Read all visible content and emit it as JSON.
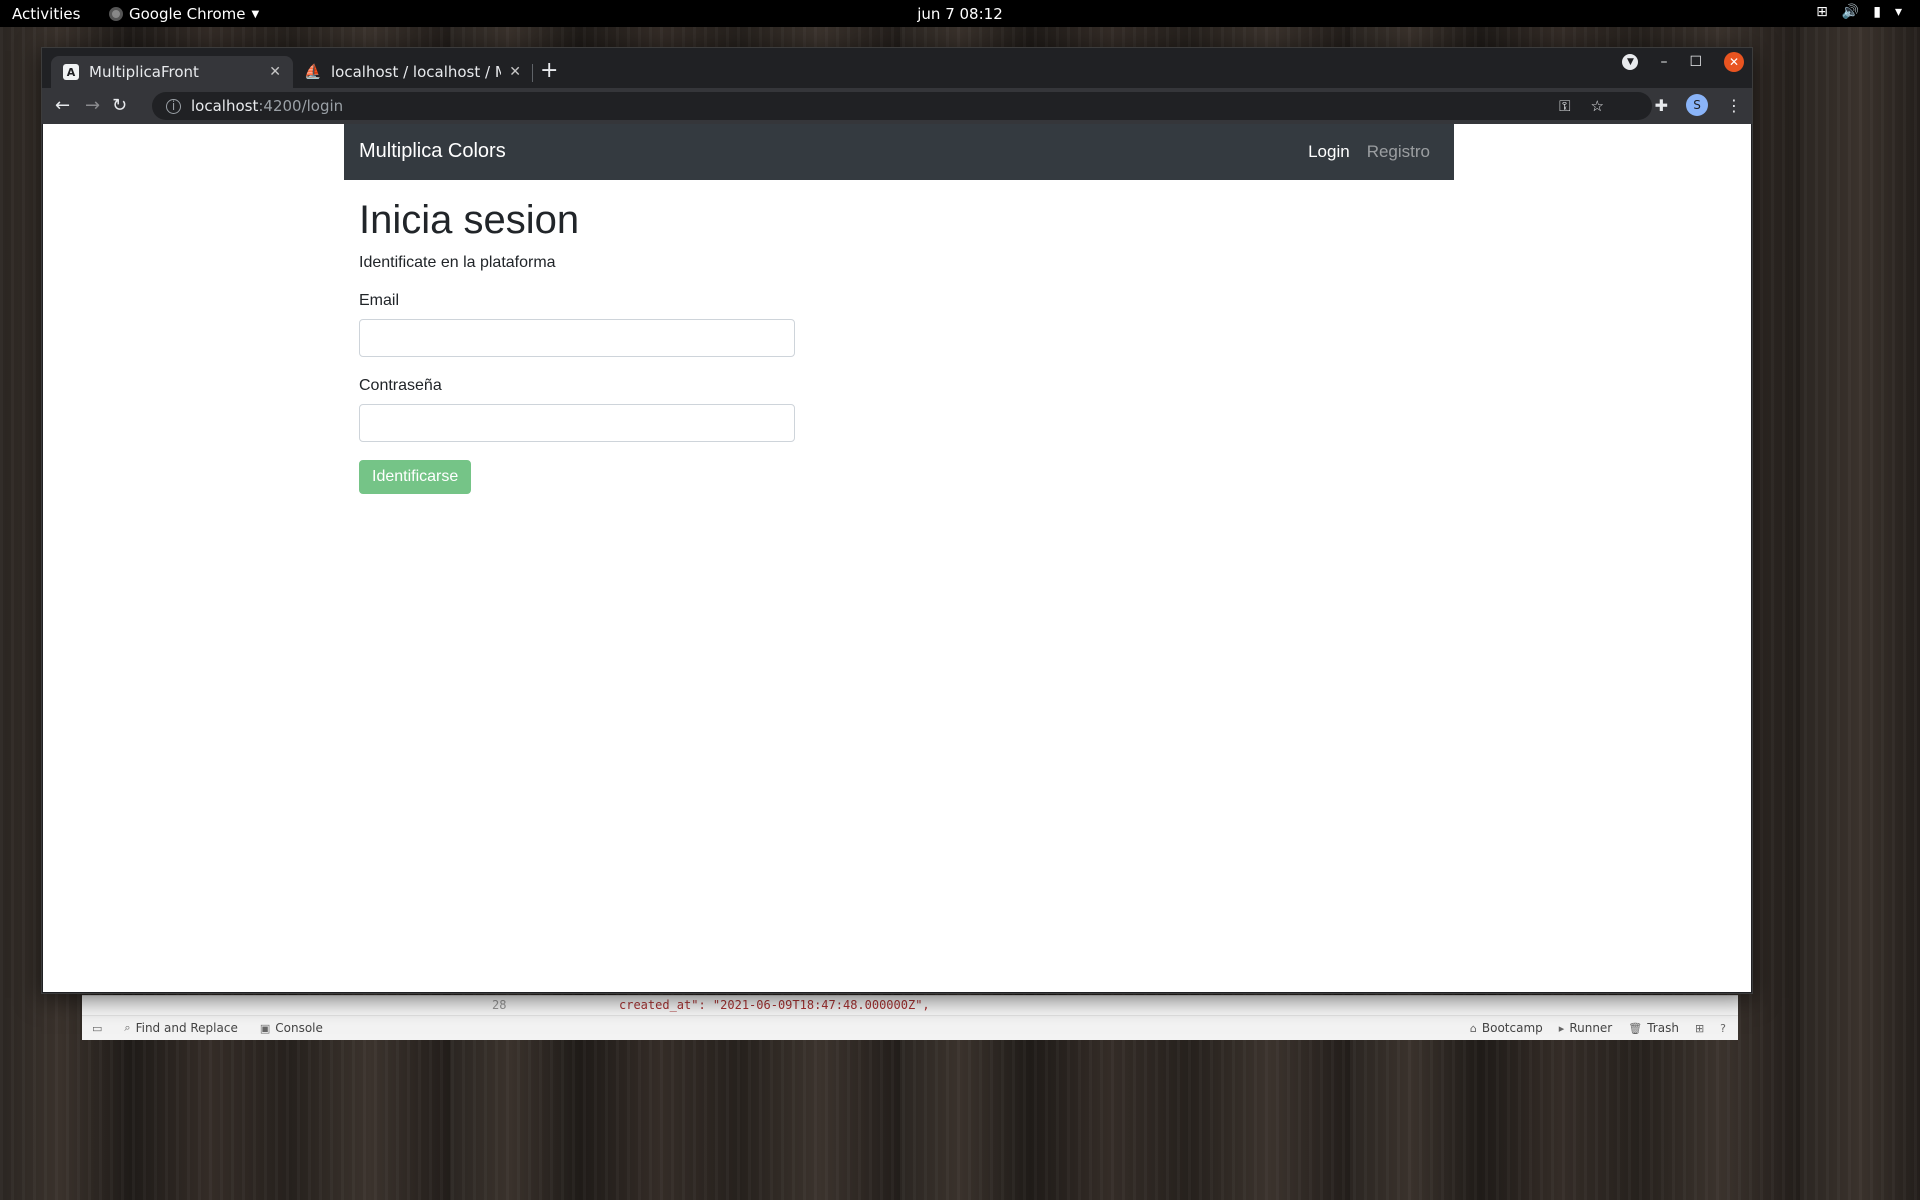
{
  "os": {
    "activities": "Activities",
    "app_menu": "Google Chrome",
    "clock": "jun 7  08:12",
    "tray_icons": [
      "network-icon",
      "volume-icon",
      "battery-icon",
      "system-menu-icon"
    ]
  },
  "browser": {
    "tabs": [
      {
        "title": "MultiplicaFront",
        "favicon": "A",
        "active": true
      },
      {
        "title": "localhost / localhost / Mu",
        "favicon": "phpmyadmin-icon",
        "active": false
      }
    ],
    "url": {
      "host": "localhost",
      "path": ":4200/login"
    }
  },
  "page": {
    "navbar": {
      "brand": "Multiplica Colors",
      "links": [
        {
          "label": "Login",
          "active": true
        },
        {
          "label": "Registro",
          "active": false
        }
      ]
    },
    "title": "Inicia sesion",
    "subtitle": "Identificate en la plataforma",
    "form": {
      "email_label": "Email",
      "email_value": "",
      "password_label": "Contraseña",
      "password_value": "",
      "submit_label": "Identificarse"
    }
  },
  "background_window": {
    "code_line_number": "28",
    "code_text": "created_at\": \"2021-06-09T18:47:48.000000Z\",",
    "status_left": [
      "Find and Replace",
      "Console"
    ],
    "status_right": [
      "Bootcamp",
      "Runner",
      "Trash"
    ]
  },
  "colors": {
    "navbar_bg": "#343a40",
    "button_success_disabled": "#75c487",
    "ubuntu_close": "#e95420"
  }
}
